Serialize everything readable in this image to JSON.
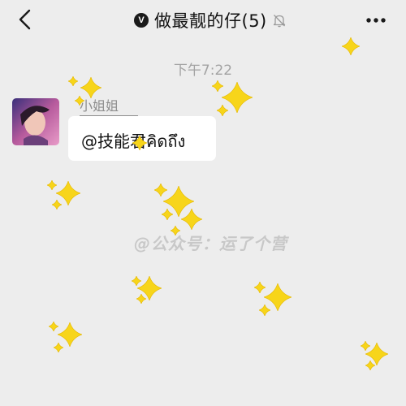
{
  "header": {
    "back_icon": "chevron-left-icon",
    "verified_badge": "V",
    "title": "做最靓的仔(5)",
    "mute_icon": "bell-off-icon",
    "more_icon": "more-dots-icon"
  },
  "chat": {
    "timestamp": "下午7:22",
    "messages": [
      {
        "sender": "小姐姐",
        "text": "@技能君คิดถึง"
      }
    ]
  },
  "watermark": "@公众号：运了个营",
  "colors": {
    "background": "#ededed",
    "bubble": "#ffffff",
    "sparkle": "#f7d51a",
    "timestamp": "#a3a3a3"
  }
}
